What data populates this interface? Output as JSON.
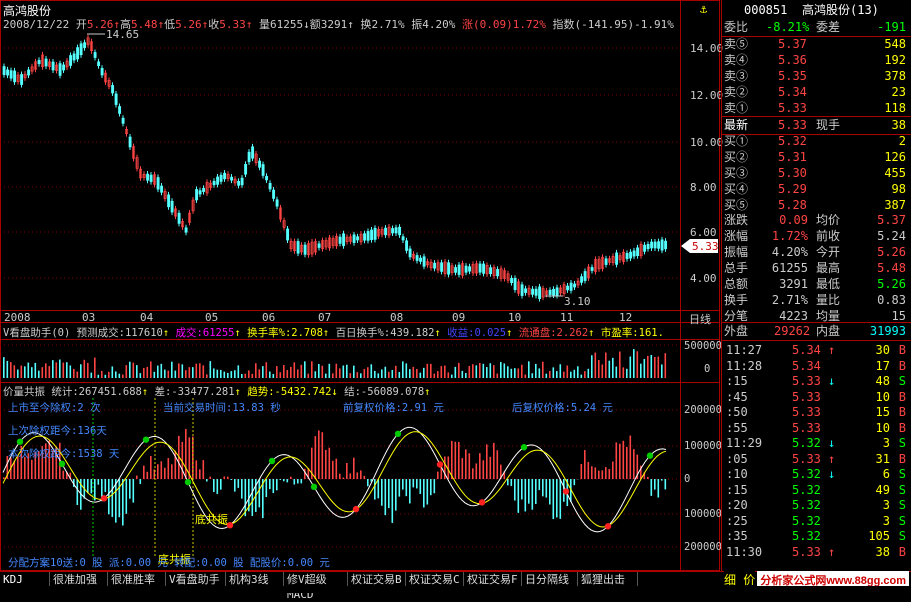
{
  "title": "高鸿股份",
  "header": {
    "date": "2008/12/22",
    "open_label": "开",
    "open": "5.26",
    "high_label": "高",
    "high": "5.48",
    "low_label": "低",
    "low": "5.26",
    "close_label": "收",
    "close": "5.33",
    "vol_label": "量",
    "vol": "61255",
    "amount_label": "额",
    "amount": "3291",
    "turnover_label": "换",
    "turnover": "2.71%",
    "amp_label": "振",
    "amp": "4.20%",
    "chg_label": "涨",
    "chg": "(0.09)",
    "chg_pct": "1.72%",
    "index_label": "指数",
    "index_val": "(-141.95)",
    "index_pct": "-1.91%"
  },
  "price_axis": [
    "14.00",
    "12.00",
    "10.00",
    "8.00",
    "6.00",
    "4.00"
  ],
  "current_price_tag": "5.33",
  "max_label": "14.65",
  "min_label": "3.10",
  "month_labels": [
    "2008",
    "03",
    "04",
    "05",
    "06",
    "07",
    "08",
    "09",
    "10",
    "11",
    "12"
  ],
  "period_label": "日线",
  "vol_panel": {
    "title": "V看盘助手(0)",
    "pred_label": "预测成交:117610",
    "vol_text": "成交:61255",
    "turn_text": "换手率%:2.708",
    "hundred_text": "百日换手%:439.182",
    "pe_text": "收益:0.025",
    "float_text": "流通盘:2.262",
    "mkt_text": "市盈率:161.",
    "axis": [
      "500000",
      "0"
    ]
  },
  "ind_panel": {
    "title": "价量共振",
    "stat_text": "统计:267451.688",
    "diff_text": "差:-33477.281",
    "trend_text": "趋势:-5432.742",
    "end_text": "结:-56089.078",
    "line1a": "上市至今除权:2 次",
    "line1b": "当前交易时间:13.83 秒",
    "line1c": "前复权价格:2.91 元",
    "line1d": "后复权价格:5.24 元",
    "line2": "上次除权距今:136天",
    "line3": "本次除权距今:1538 天",
    "label_bottom": "底共振",
    "label_bottom2": "底共振",
    "dist_text": "分配方案10送:0 股 派:0.00 元 转配:0.00 股 配股价:0.00 元",
    "axis": [
      "200000",
      "100000",
      "0",
      "100000",
      "200000"
    ]
  },
  "quote": {
    "code": "000851",
    "name": "高鸿股份(13)",
    "ratio_label": "委比",
    "ratio": "-8.21%",
    "diff_label": "委差",
    "diff": "-191",
    "asks": [
      {
        "label": "卖⑤",
        "price": "5.37",
        "vol": "548"
      },
      {
        "label": "卖④",
        "price": "5.36",
        "vol": "192"
      },
      {
        "label": "卖③",
        "price": "5.35",
        "vol": "378"
      },
      {
        "label": "卖②",
        "price": "5.34",
        "vol": "23"
      },
      {
        "label": "卖①",
        "price": "5.33",
        "vol": "118"
      }
    ],
    "last_label": "最新",
    "last": "5.33",
    "cur_label": "现手",
    "cur": "38",
    "bids": [
      {
        "label": "买①",
        "price": "5.32",
        "vol": "2"
      },
      {
        "label": "买②",
        "price": "5.31",
        "vol": "126"
      },
      {
        "label": "买③",
        "price": "5.30",
        "vol": "455"
      },
      {
        "label": "买④",
        "price": "5.29",
        "vol": "98"
      },
      {
        "label": "买⑤",
        "price": "5.28",
        "vol": "387"
      }
    ],
    "stats": [
      {
        "l1": "涨跌",
        "v1": "0.09",
        "l2": "均价",
        "v2": "5.37"
      },
      {
        "l1": "涨幅",
        "v1": "1.72%",
        "l2": "前收",
        "v2": "5.24"
      },
      {
        "l1": "振幅",
        "v1": "4.20%",
        "l2": "今开",
        "v2": "5.26"
      },
      {
        "l1": "总手",
        "v1": "61255",
        "l2": "最高",
        "v2": "5.48"
      },
      {
        "l1": "总额",
        "v1": "3291",
        "l2": "最低",
        "v2": "5.26"
      },
      {
        "l1": "换手",
        "v1": "2.71%",
        "l2": "量比",
        "v2": "0.83"
      },
      {
        "l1": "分笔",
        "v1": "4223",
        "l2": "均量",
        "v2": "15"
      }
    ],
    "outer_label": "外盘",
    "outer": "29262",
    "inner_label": "内盘",
    "inner": "31993"
  },
  "trades": [
    {
      "time": "11:27",
      "price": "5.34",
      "dir": "↑",
      "vol": "30",
      "bs": "B"
    },
    {
      "time": "11:28",
      "price": "5.34",
      "dir": "",
      "vol": "17",
      "bs": "B"
    },
    {
      "time": ":15",
      "price": "5.33",
      "dir": "↓",
      "vol": "48",
      "bs": "S"
    },
    {
      "time": ":45",
      "price": "5.33",
      "dir": "",
      "vol": "10",
      "bs": "B"
    },
    {
      "time": ":50",
      "price": "5.33",
      "dir": "",
      "vol": "15",
      "bs": "B"
    },
    {
      "time": ":55",
      "price": "5.33",
      "dir": "",
      "vol": "10",
      "bs": "B"
    },
    {
      "time": "11:29",
      "price": "5.32",
      "dir": "↓",
      "vol": "3",
      "bs": "S"
    },
    {
      "time": ":05",
      "price": "5.33",
      "dir": "↑",
      "vol": "31",
      "bs": "B"
    },
    {
      "time": ":10",
      "price": "5.32",
      "dir": "↓",
      "vol": "6",
      "bs": "S"
    },
    {
      "time": ":15",
      "price": "5.32",
      "dir": "",
      "vol": "49",
      "bs": "S"
    },
    {
      "time": ":20",
      "price": "5.32",
      "dir": "",
      "vol": "3",
      "bs": "S"
    },
    {
      "time": ":25",
      "price": "5.32",
      "dir": "",
      "vol": "3",
      "bs": "S"
    },
    {
      "time": ":35",
      "price": "5.32",
      "dir": "",
      "vol": "105",
      "bs": "S"
    },
    {
      "time": "11:30",
      "price": "5.33",
      "dir": "↑",
      "vol": "38",
      "bs": "B"
    }
  ],
  "tabs": [
    "KDJ",
    "很准加强",
    "很准胜率",
    "V看盘助手",
    "机构3线",
    "修V超级MACD",
    "权证交易B",
    "权证交易C",
    "权证交易F",
    "日分隔线",
    "狐狸出击"
  ],
  "tail_text": "细 价",
  "watermark": "分析家公式网www.88gg.com"
}
